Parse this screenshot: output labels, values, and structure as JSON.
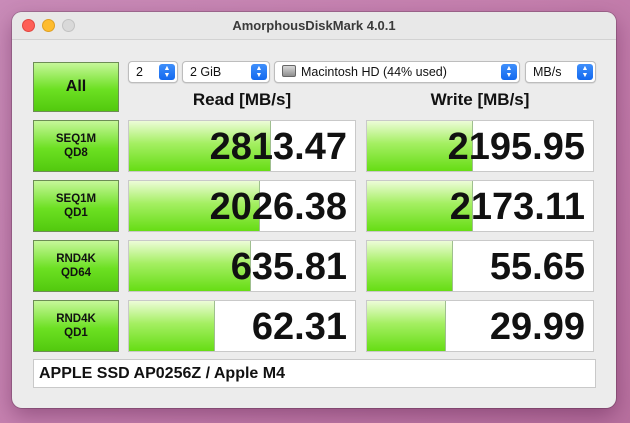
{
  "window": {
    "title": "AmorphousDiskMark 4.0.1"
  },
  "controls": {
    "all_label": "All",
    "count": "2",
    "size": "2 GiB",
    "disk": "Macintosh HD (44% used)",
    "unit": "MB/s"
  },
  "headers": {
    "read": "Read [MB/s]",
    "write": "Write [MB/s]"
  },
  "tests": [
    {
      "line1": "SEQ1M",
      "line2": "QD8",
      "read": "2813.47",
      "write": "2195.95",
      "read_fill": 0.63,
      "write_fill": 0.47
    },
    {
      "line1": "SEQ1M",
      "line2": "QD1",
      "read": "2026.38",
      "write": "2173.11",
      "read_fill": 0.58,
      "write_fill": 0.47
    },
    {
      "line1": "RND4K",
      "line2": "QD64",
      "read": "635.81",
      "write": "55.65",
      "read_fill": 0.54,
      "write_fill": 0.38
    },
    {
      "line1": "RND4K",
      "line2": "QD1",
      "read": "62.31",
      "write": "29.99",
      "read_fill": 0.38,
      "write_fill": 0.35
    }
  ],
  "footer": {
    "device": "APPLE SSD AP0256Z / Apple M4"
  },
  "colors": {
    "green": "#6ce022",
    "close": "#fe5f57",
    "minimize": "#febc2e",
    "accent": "#1369ef"
  }
}
